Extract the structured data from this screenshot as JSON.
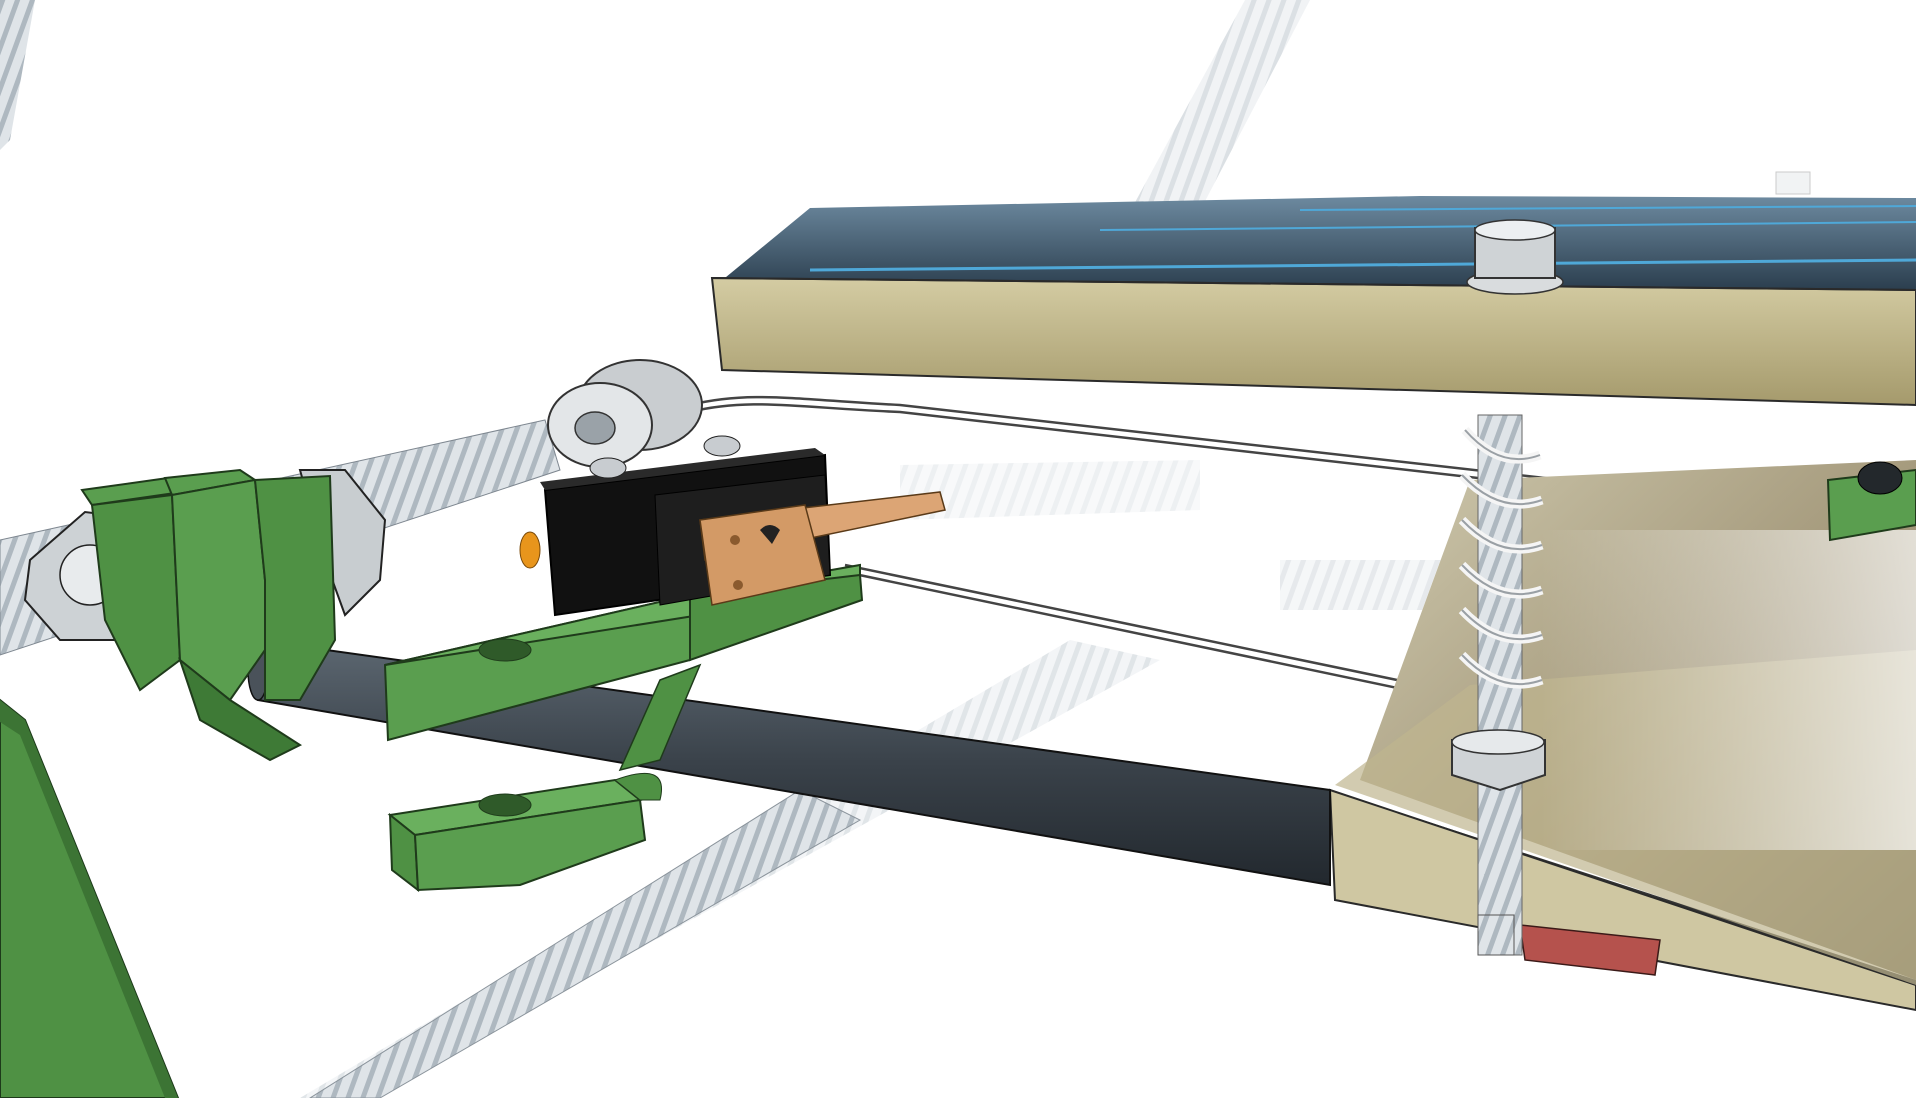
{
  "scene": {
    "description_label": "",
    "colors": {
      "background": "#ffffff",
      "printed_part_green": "#5a9e4f",
      "printed_part_green_dark": "#3e7a36",
      "threaded_rod": "#d9dee3",
      "smooth_rod": "#3c444c",
      "bed_wood": "#c9c19a",
      "bed_wood_dark": "#8f8560",
      "glass": "#3e5a6e",
      "glass_edge": "#4fa8d8",
      "switch_body": "#161616",
      "switch_lever": "#d8a070",
      "spring": "#f2f2f2",
      "wire": "#555555",
      "nut_metal": "#cfd3d6",
      "heater_red": "#b5524d",
      "led_orange": "#e8951c"
    },
    "icons": {
      "left_nut_pair": "hex-nut-icon",
      "bed_screw": "cap-screw-icon",
      "endstop": "microswitch-icon",
      "spring": "coil-spring-icon"
    }
  }
}
